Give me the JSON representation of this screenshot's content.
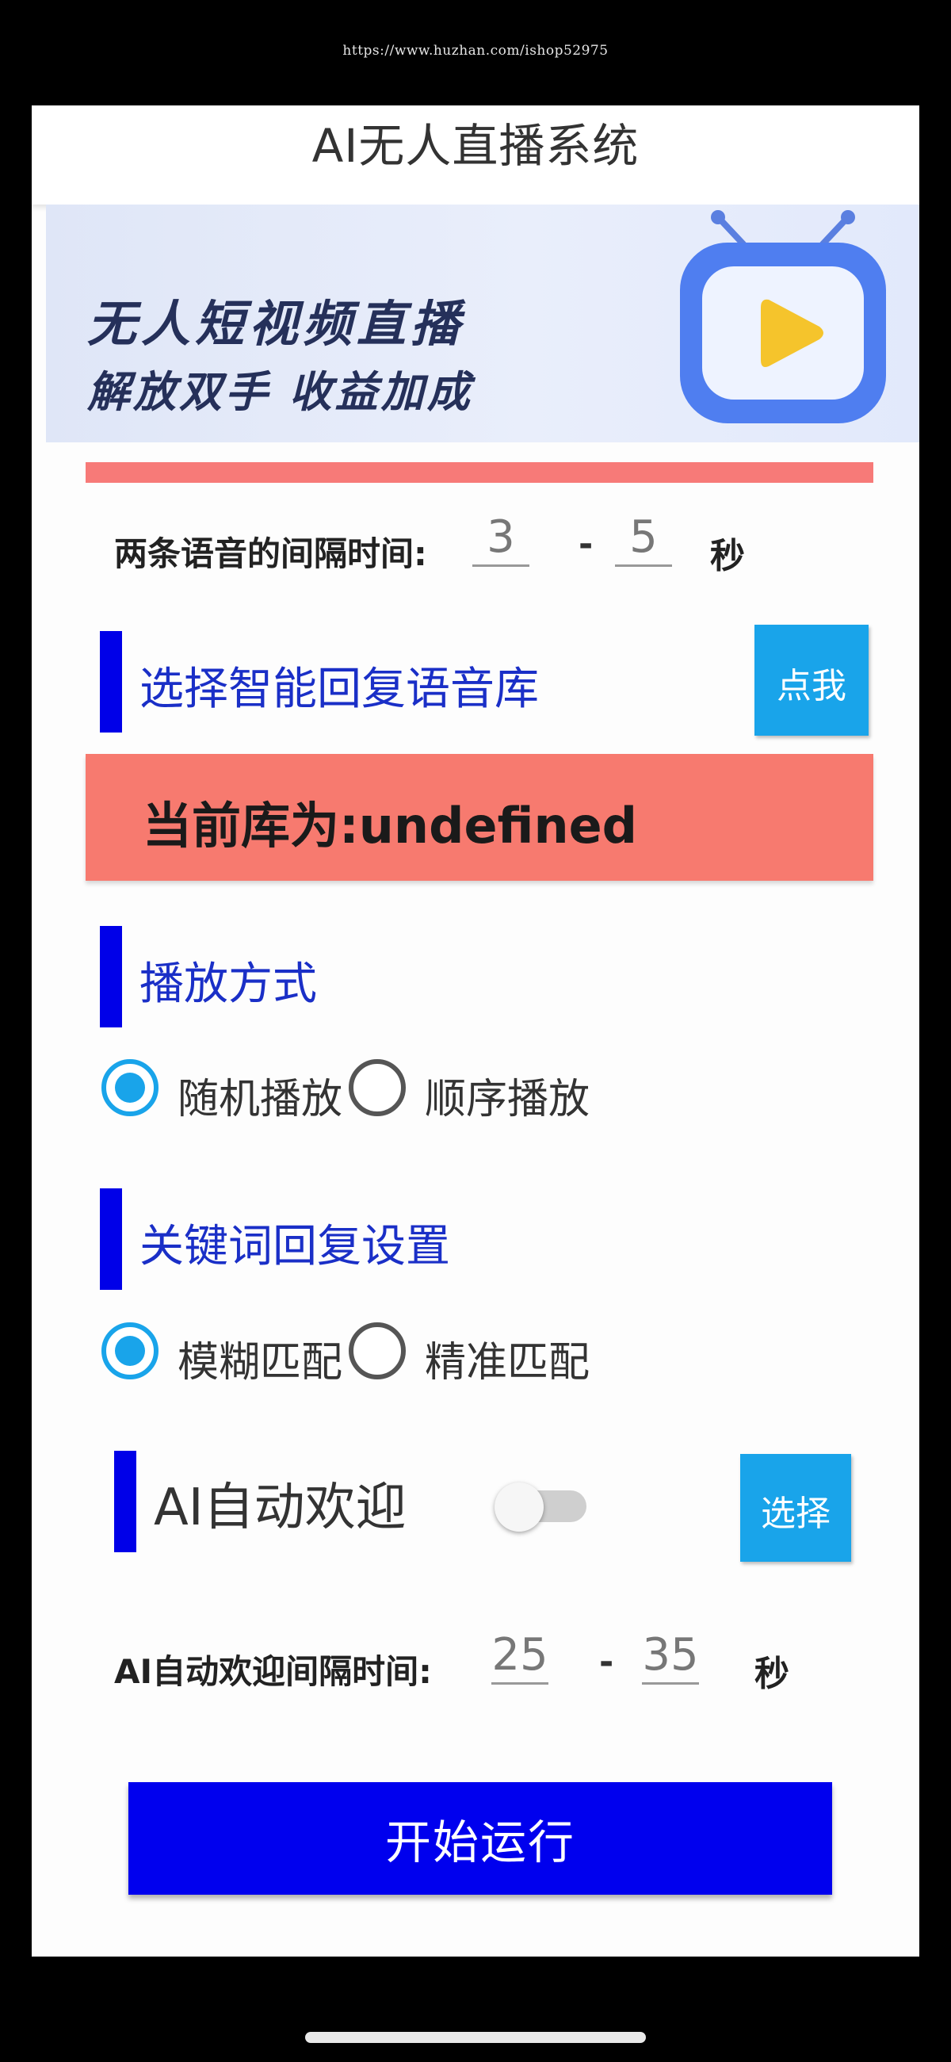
{
  "watermark": "https://www.huzhan.com/ishop52975",
  "header": {
    "title": "AI无人直播系统"
  },
  "banner": {
    "line1": "无人短视频直播",
    "line2": "解放双手 收益加成"
  },
  "voice_interval": {
    "label": "两条语音的间隔时间:",
    "min": "3",
    "dash": "-",
    "max": "5",
    "unit": "秒"
  },
  "library": {
    "title": "选择智能回复语音库",
    "button_label": "点我",
    "current": "当前库为:undefined"
  },
  "playback": {
    "title": "播放方式",
    "options": [
      {
        "label": "随机播放",
        "selected": true
      },
      {
        "label": "顺序播放",
        "selected": false
      }
    ]
  },
  "keyword": {
    "title": "关键词回复设置",
    "options": [
      {
        "label": "模糊匹配",
        "selected": true
      },
      {
        "label": "精准匹配",
        "selected": false
      }
    ]
  },
  "welcome": {
    "title": "AI自动欢迎",
    "enabled": false,
    "button_label": "选择"
  },
  "welcome_interval": {
    "label": "AI自动欢迎间隔时间:",
    "min": "25",
    "dash": "-",
    "max": "35",
    "unit": "秒"
  },
  "start_button": "开始运行",
  "colors": {
    "accent_blue": "#0000e8",
    "button_cyan": "#19a4ea",
    "alert_salmon": "#f77a6f",
    "title_blue": "#1a2fc7"
  }
}
